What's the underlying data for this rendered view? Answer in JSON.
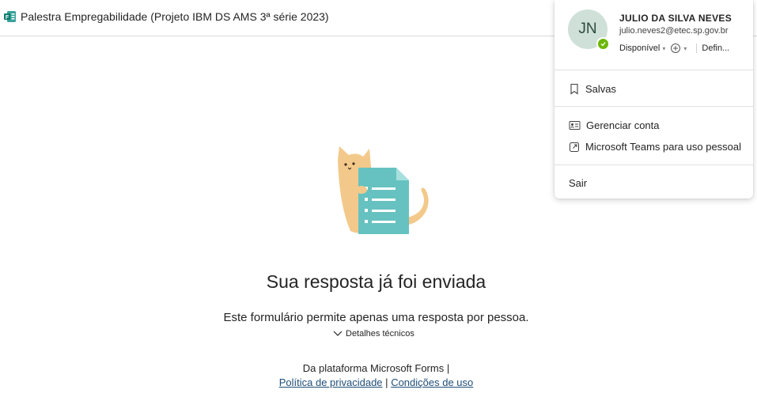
{
  "header": {
    "form_title": "Palestra Empregabilidade (Projeto IBM DS AMS 3ª série 2023)"
  },
  "main": {
    "headline": "Sua resposta já foi enviada",
    "subtext": "Este formulário permite apenas uma resposta por pessoa.",
    "details_label": "Detalhes técnicos",
    "footer_line1": "Da plataforma Microsoft Forms |",
    "privacy_link": "Política de privacidade",
    "separator": "|",
    "terms_link": "Condições de uso"
  },
  "account": {
    "initials": "JN",
    "name": "JULIO DA SILVA NEVES",
    "email": "julio.neves2@etec.sp.gov.br",
    "status": "Disponível",
    "settings_label": "Defin...",
    "presence_color": "#6bb700"
  },
  "menu": {
    "saved": "Salvas",
    "manage_account": "Gerenciar conta",
    "teams_personal": "Microsoft Teams para uso pessoal",
    "sign_out": "Sair"
  }
}
